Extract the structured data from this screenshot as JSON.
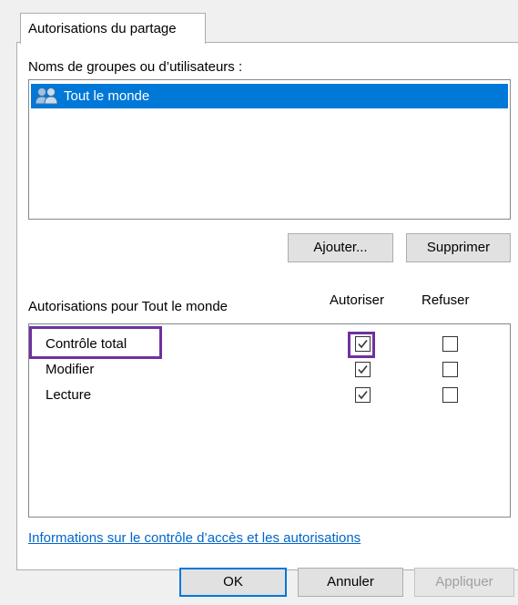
{
  "tab": {
    "label": "Autorisations du partage"
  },
  "users": {
    "heading": "Noms de groupes ou d’utilisateurs :",
    "items": [
      {
        "label": "Tout le monde",
        "icon": "users-group-icon",
        "selected": true
      }
    ]
  },
  "user_buttons": {
    "add": "Ajouter...",
    "remove": "Supprimer"
  },
  "permissions": {
    "heading": "Autorisations pour Tout le monde",
    "allow_header": "Autoriser",
    "deny_header": "Refuser",
    "rows": [
      {
        "label": "Contrôle total",
        "allow": true,
        "deny": false
      },
      {
        "label": "Modifier",
        "allow": true,
        "deny": false
      },
      {
        "label": "Lecture",
        "allow": true,
        "deny": false
      }
    ]
  },
  "link": {
    "text": "Informations sur le contrôle d’accès et les autorisations"
  },
  "dialog_buttons": {
    "ok": "OK",
    "cancel": "Annuler",
    "apply": "Appliquer"
  },
  "colors": {
    "selection": "#0078d7",
    "highlight": "#7030a0",
    "link": "#0066cc"
  }
}
